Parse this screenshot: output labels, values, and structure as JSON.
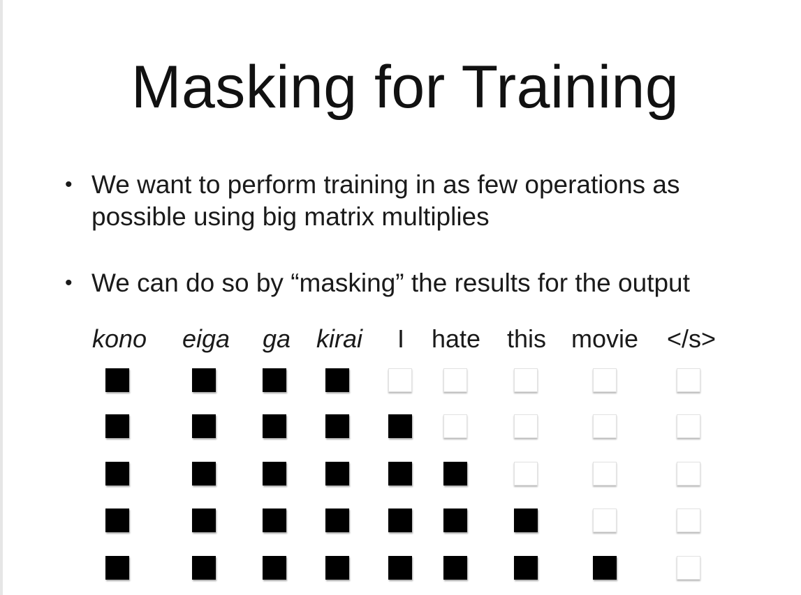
{
  "slide": {
    "title": "Masking for Training",
    "bullets": [
      {
        "line1": "We want to perform training in as few operations as",
        "line2": "possible using big matrix multiplies"
      },
      {
        "line1": "We can do so by “masking” the results for the output"
      }
    ]
  },
  "mask_diagram": {
    "columns": [
      {
        "word": "kono",
        "italic": true
      },
      {
        "word": "eiga",
        "italic": true
      },
      {
        "word": "ga",
        "italic": true
      },
      {
        "word": "kirai",
        "italic": true
      },
      {
        "word": "I",
        "italic": false
      },
      {
        "word": "hate",
        "italic": false
      },
      {
        "word": "this",
        "italic": false
      },
      {
        "word": "movie",
        "italic": false
      },
      {
        "word": "</s>",
        "italic": false
      }
    ],
    "rows": [
      [
        1,
        1,
        1,
        1,
        0,
        0,
        0,
        0,
        0
      ],
      [
        1,
        1,
        1,
        1,
        1,
        0,
        0,
        0,
        0
      ],
      [
        1,
        1,
        1,
        1,
        1,
        1,
        0,
        0,
        0
      ],
      [
        1,
        1,
        1,
        1,
        1,
        1,
        1,
        0,
        0
      ],
      [
        1,
        1,
        1,
        1,
        1,
        1,
        1,
        1,
        0
      ]
    ],
    "on_color": "#000000",
    "off_color": "#ffffff"
  }
}
